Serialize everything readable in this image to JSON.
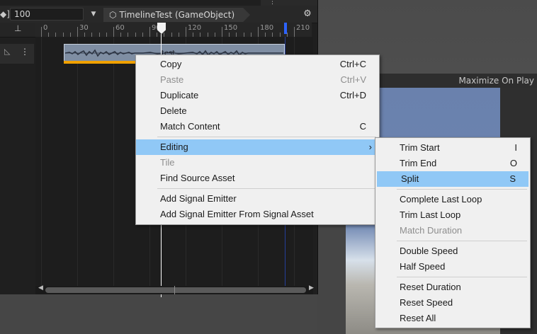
{
  "toolbar": {
    "left_bracket": "◆]",
    "frame_value": "100",
    "dropdown_glyph": "▼",
    "breadcrumb_label": "TimelineTest (GameObject)",
    "cube_glyph": "⬡",
    "settings_glyph": "⚙",
    "window_dots": "⋮"
  },
  "ruler": {
    "ticks": [
      "0",
      "30",
      "60",
      "90",
      "120",
      "150",
      "180",
      "210"
    ],
    "pin_glyph": "⊥"
  },
  "track": {
    "icon_glyph": "◺",
    "menu_glyph": "⋮",
    "clip_label": "test"
  },
  "game_view": {
    "maximize_label": "Maximize On Play"
  },
  "scroll": {
    "left_arrow": "◀",
    "right_arrow": "▶"
  },
  "context_menu": {
    "items": [
      {
        "label": "Copy",
        "shortcut": "Ctrl+C",
        "enabled": true
      },
      {
        "label": "Paste",
        "shortcut": "Ctrl+V",
        "enabled": false
      },
      {
        "label": "Duplicate",
        "shortcut": "Ctrl+D",
        "enabled": true
      },
      {
        "label": "Delete",
        "shortcut": "",
        "enabled": true
      },
      {
        "label": "Match Content",
        "shortcut": "C",
        "enabled": true
      },
      {
        "label": "Editing",
        "shortcut": "›",
        "enabled": true,
        "highlighted": true
      },
      {
        "label": "Tile",
        "shortcut": "",
        "enabled": false
      },
      {
        "label": "Find Source Asset",
        "shortcut": "",
        "enabled": true
      },
      {
        "label": "Add Signal Emitter",
        "shortcut": "",
        "enabled": true
      },
      {
        "label": "Add Signal Emitter From Signal Asset",
        "shortcut": "",
        "enabled": true
      }
    ]
  },
  "submenu": {
    "items": [
      {
        "label": "Trim Start",
        "shortcut": "I",
        "enabled": true
      },
      {
        "label": "Trim End",
        "shortcut": "O",
        "enabled": true
      },
      {
        "label": "Split",
        "shortcut": "S",
        "enabled": true,
        "highlighted": true
      },
      {
        "label": "Complete Last Loop",
        "shortcut": "",
        "enabled": true
      },
      {
        "label": "Trim Last Loop",
        "shortcut": "",
        "enabled": true
      },
      {
        "label": "Match Duration",
        "shortcut": "",
        "enabled": false
      },
      {
        "label": "Double Speed",
        "shortcut": "",
        "enabled": true
      },
      {
        "label": "Half Speed",
        "shortcut": "",
        "enabled": true
      },
      {
        "label": "Reset Duration",
        "shortcut": "",
        "enabled": true
      },
      {
        "label": "Reset Speed",
        "shortcut": "",
        "enabled": true
      },
      {
        "label": "Reset All",
        "shortcut": "",
        "enabled": true
      }
    ]
  },
  "colors": {
    "clip": "#7f8ea3",
    "clip_bar": "#f0a100",
    "highlight": "#90c8f6",
    "end_marker": "#2d63ff"
  }
}
